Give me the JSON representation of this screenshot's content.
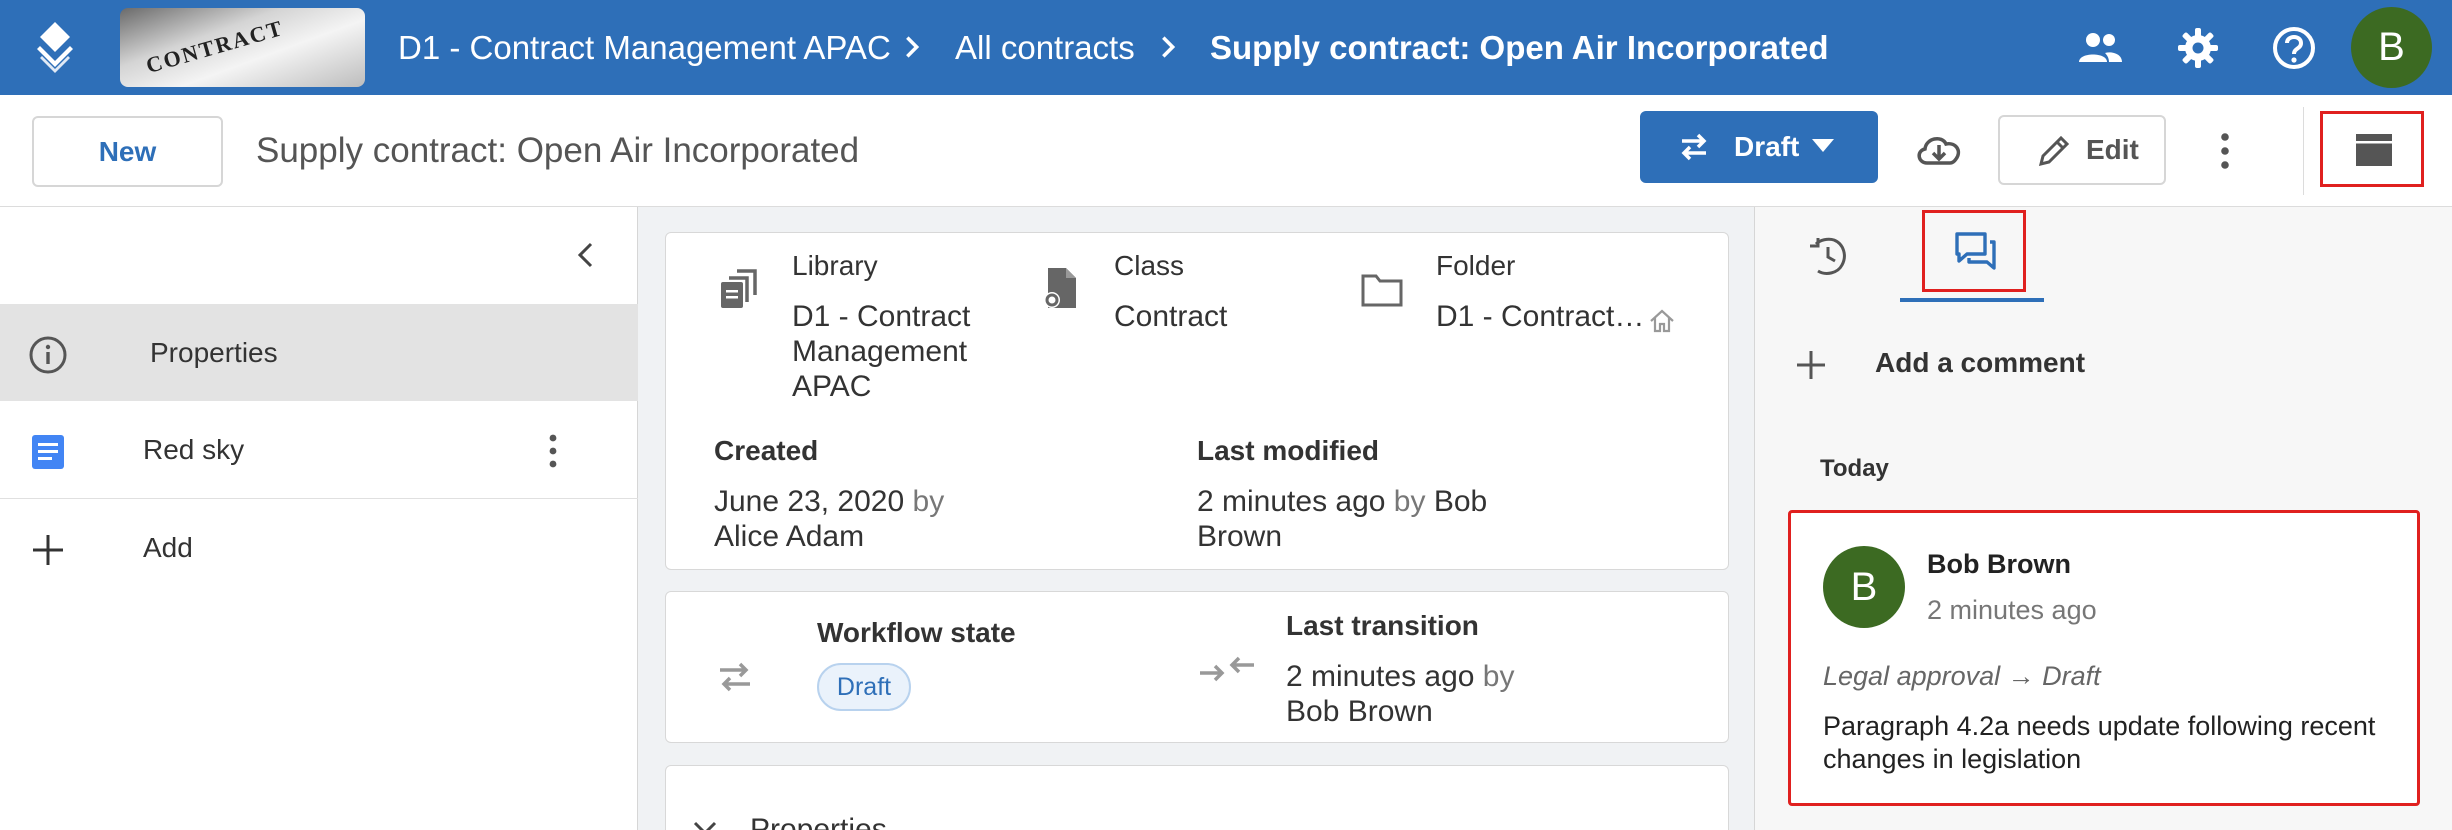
{
  "header": {
    "breadcrumbs": [
      "D1 - Contract Management APAC",
      "All contracts",
      "Supply contract: Open Air Incorporated"
    ],
    "thumbnail_text": "CONTRACT",
    "avatar_initial": "B"
  },
  "toolbar": {
    "new_label": "New",
    "title": "Supply contract: Open Air Incorporated",
    "state_label": "Draft",
    "edit_label": "Edit"
  },
  "sidebar": {
    "items": [
      {
        "label": "Properties",
        "icon": "info-icon",
        "active": true
      },
      {
        "label": "Red sky",
        "icon": "document-icon",
        "active": false
      },
      {
        "label": "Add",
        "icon": "plus-icon",
        "active": false
      }
    ]
  },
  "details": {
    "library": {
      "label": "Library",
      "value": "D1 - Contract Management APAC"
    },
    "class": {
      "label": "Class",
      "value": "Contract"
    },
    "folder": {
      "label": "Folder",
      "value": "D1 - Contract…"
    },
    "created": {
      "label": "Created",
      "date": "June 23, 2020",
      "by_word": "by",
      "by_name": "Alice Adam"
    },
    "modified": {
      "label": "Last modified",
      "date": "2 minutes ago",
      "by_word": "by",
      "by_name": "Bob Brown"
    }
  },
  "workflow": {
    "state_label": "Workflow state",
    "state_value": "Draft",
    "transition_label": "Last transition",
    "transition_time": "2 minutes ago",
    "by_word": "by",
    "transition_by": "Bob Brown"
  },
  "properties_section": {
    "label": "Properties"
  },
  "comments": {
    "add_label": "Add a comment",
    "group_label": "Today",
    "items": [
      {
        "initial": "B",
        "author": "Bob Brown",
        "time": "2 minutes ago",
        "transition": "Legal approval → Draft",
        "text": "Paragraph 4.2a needs update following recent changes in legislation"
      }
    ]
  },
  "colors": {
    "brand": "#2e6fb8",
    "avatar": "#3c6a22",
    "highlight": "#e0201f"
  }
}
